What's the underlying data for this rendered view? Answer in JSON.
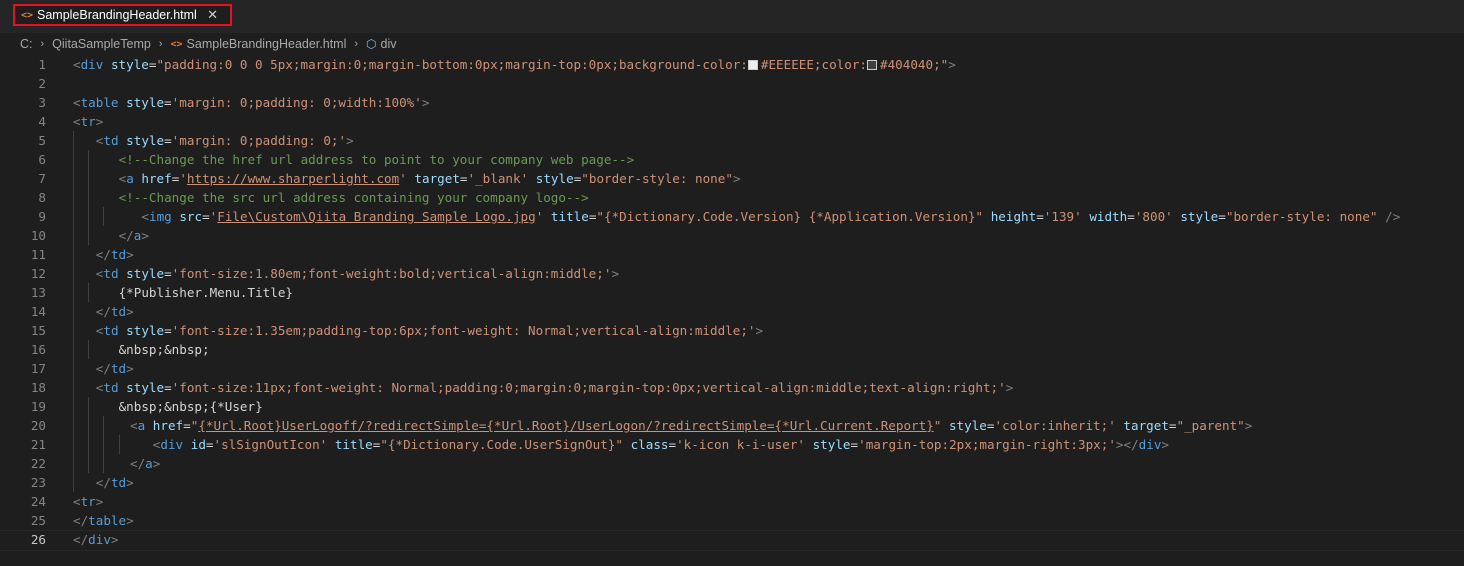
{
  "tab": {
    "file_icon": "<>",
    "filename": "SampleBrandingHeader.html",
    "close": "✕"
  },
  "breadcrumb": {
    "drive": "C:",
    "folder": "QiitaSampleTemp",
    "file": "SampleBrandingHeader.html",
    "element": "div",
    "sep": "›"
  },
  "colors": {
    "swatch1": "#EEEEEE",
    "swatch2": "#404040"
  },
  "code_lines": [
    "<div style=\"padding:0 0 0 5px;margin:0;margin-bottom:0px;margin-top:0px;background-color:#EEEEEE;color:#404040;\">",
    "",
    "<table style='margin: 0;padding: 0;width:100%'>",
    "<tr>",
    "<td style='margin: 0;padding: 0;'>",
    "<!--Change the href url address to point to your company web page-->",
    "<a href='https://www.sharperlight.com' target='_blank' style=\"border-style: none\">",
    "<!--Change the src url address containing your company logo-->",
    "<img src='File\\Custom\\Qiita Branding Sample Logo.jpg' title=\"{*Dictionary.Code.Version} {*Application.Version}\" height='139' width='800' style=\"border-style: none\" />",
    "</a>",
    "</td>",
    "<td style='font-size:1.80em;font-weight:bold;vertical-align:middle;'>",
    "{*Publisher.Menu.Title}",
    "</td>",
    "<td style='font-size:1.35em;padding-top:6px;font-weight: Normal;vertical-align:middle;'>",
    "&nbsp;&nbsp;",
    "</td>",
    "<td style='font-size:11px;font-weight: Normal;padding:0;margin:0;margin-top:0px;vertical-align:middle;text-align:right;'>",
    "&nbsp;&nbsp;{*User}",
    "<a href=\"{*Url.Root}UserLogoff/?redirectSimple={*Url.Root}/UserLogon/?redirectSimple={*Url.Current.Report}\" style='color:inherit;' target=\"_parent\">",
    "<div id='slSignOutIcon' title=\"{*Dictionary.Code.UserSignOut}\" class='k-icon k-i-user' style='margin-top:2px;margin-right:3px;'></div>",
    "</a>",
    "</td>",
    "<tr>",
    "</table>",
    "</div>"
  ],
  "line_numbers": [
    "1",
    "2",
    "3",
    "4",
    "5",
    "6",
    "7",
    "8",
    "9",
    "10",
    "11",
    "12",
    "13",
    "14",
    "15",
    "16",
    "17",
    "18",
    "19",
    "20",
    "21",
    "22",
    "23",
    "24",
    "25",
    "26"
  ],
  "active_line": 26
}
